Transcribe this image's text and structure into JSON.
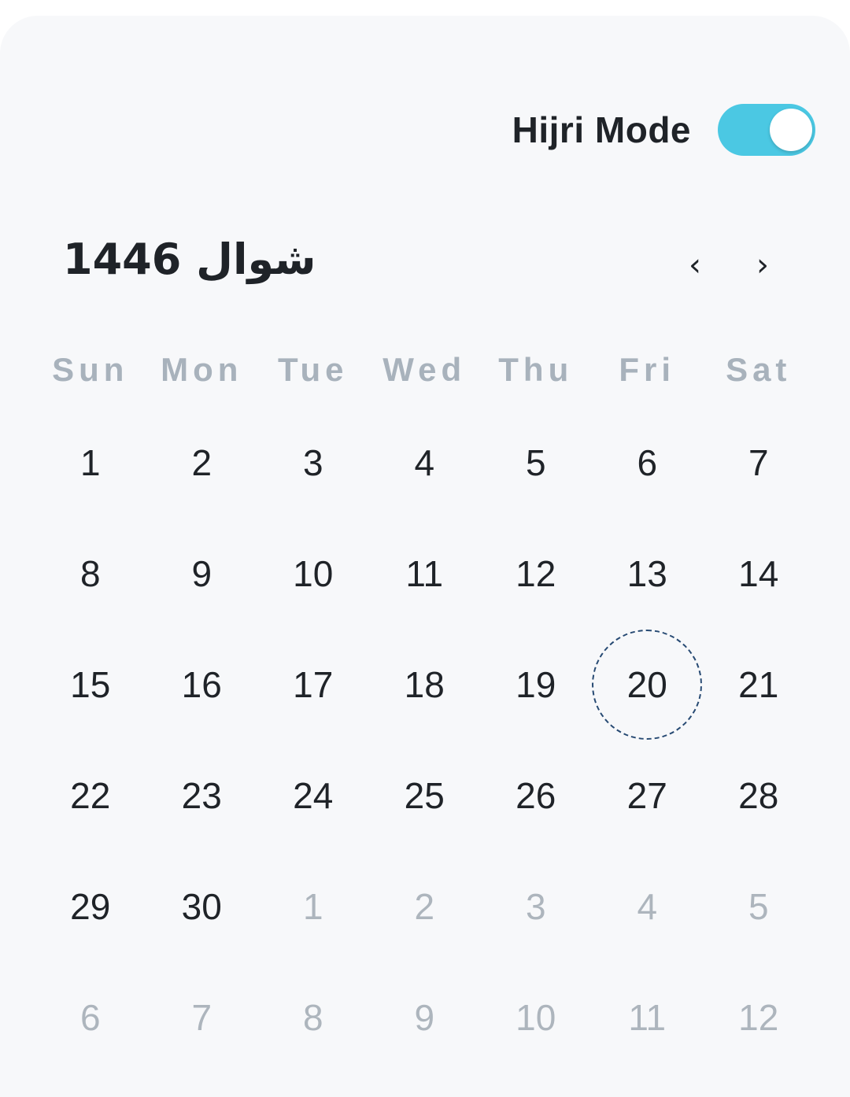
{
  "toggle": {
    "label": "Hijri Mode",
    "on": true,
    "color": "#4bc8e3"
  },
  "header": {
    "month_title": "شوال 1446",
    "prev_icon": "‹",
    "next_icon": "›"
  },
  "weekdays": [
    "Sun",
    "Mon",
    "Tue",
    "Wed",
    "Thu",
    "Fri",
    "Sat"
  ],
  "weeks": [
    [
      {
        "d": "1"
      },
      {
        "d": "2"
      },
      {
        "d": "3"
      },
      {
        "d": "4"
      },
      {
        "d": "5"
      },
      {
        "d": "6"
      },
      {
        "d": "7"
      }
    ],
    [
      {
        "d": "8"
      },
      {
        "d": "9"
      },
      {
        "d": "10"
      },
      {
        "d": "11"
      },
      {
        "d": "12"
      },
      {
        "d": "13"
      },
      {
        "d": "14"
      }
    ],
    [
      {
        "d": "15"
      },
      {
        "d": "16"
      },
      {
        "d": "17"
      },
      {
        "d": "18"
      },
      {
        "d": "19"
      },
      {
        "d": "20",
        "today": true
      },
      {
        "d": "21"
      }
    ],
    [
      {
        "d": "22"
      },
      {
        "d": "23"
      },
      {
        "d": "24"
      },
      {
        "d": "25"
      },
      {
        "d": "26"
      },
      {
        "d": "27"
      },
      {
        "d": "28"
      }
    ],
    [
      {
        "d": "29"
      },
      {
        "d": "30"
      },
      {
        "d": "1",
        "muted": true
      },
      {
        "d": "2",
        "muted": true
      },
      {
        "d": "3",
        "muted": true
      },
      {
        "d": "4",
        "muted": true
      },
      {
        "d": "5",
        "muted": true
      }
    ],
    [
      {
        "d": "6",
        "muted": true
      },
      {
        "d": "7",
        "muted": true
      },
      {
        "d": "8",
        "muted": true
      },
      {
        "d": "9",
        "muted": true
      },
      {
        "d": "10",
        "muted": true
      },
      {
        "d": "11",
        "muted": true
      },
      {
        "d": "12",
        "muted": true
      }
    ]
  ],
  "colors": {
    "text": "#1f2328",
    "muted": "#adb5bd",
    "weekday": "#a8b2bc",
    "today_ring": "#274a73",
    "background": "#f7f8fa"
  }
}
